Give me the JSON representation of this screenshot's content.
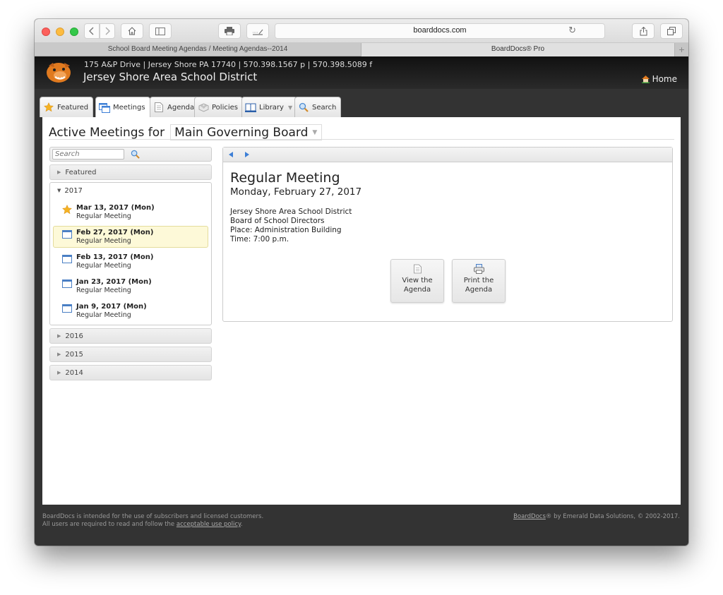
{
  "browser": {
    "url": "boarddocs.com",
    "tabs": [
      {
        "label": "School Board Meeting Agendas / Meeting Agendas--2014",
        "active": false
      },
      {
        "label": "BoardDocs® Pro",
        "active": true
      }
    ],
    "new_tab_label": "+"
  },
  "header": {
    "address": "175 A&P Drive | Jersey Shore PA 17740 | 570.398.1567 p | 570.398.5089 f",
    "district_name": "Jersey Shore Area School District",
    "home_label": "Home"
  },
  "nav": {
    "tabs": [
      {
        "label": "Featured",
        "icon": "star-icon",
        "active": false
      },
      {
        "label": "Meetings",
        "icon": "meetings-icon",
        "active": true
      },
      {
        "label": "Agenda",
        "icon": "document-icon",
        "active": false
      },
      {
        "label": "Policies",
        "icon": "policies-icon",
        "active": false
      },
      {
        "label": "Library",
        "icon": "book-icon",
        "active": false,
        "has_dropdown": true
      },
      {
        "label": "Search",
        "icon": "magnifier-icon",
        "active": false
      }
    ]
  },
  "page": {
    "title_prefix": "Active Meetings for",
    "board_selected": "Main Governing Board"
  },
  "sidebar": {
    "search_placeholder": "Search",
    "featured_label": "Featured",
    "open_year": "2017",
    "meetings": [
      {
        "date": "Mar 13, 2017 (Mon)",
        "type": "Regular Meeting",
        "icon": "star-icon",
        "selected": false
      },
      {
        "date": "Feb 27, 2017 (Mon)",
        "type": "Regular Meeting",
        "icon": "calendar-icon",
        "selected": true
      },
      {
        "date": "Feb 13, 2017 (Mon)",
        "type": "Regular Meeting",
        "icon": "calendar-icon",
        "selected": false
      },
      {
        "date": "Jan 23, 2017 (Mon)",
        "type": "Regular Meeting",
        "icon": "calendar-icon",
        "selected": false
      },
      {
        "date": "Jan 9, 2017 (Mon)",
        "type": "Regular Meeting",
        "icon": "calendar-icon",
        "selected": false
      }
    ],
    "collapsed_years": [
      "2016",
      "2015",
      "2014"
    ]
  },
  "detail": {
    "title": "Regular Meeting",
    "date": "Monday, February 27, 2017",
    "lines": [
      "Jersey Shore Area School District",
      "Board of School Directors",
      "Place: Administration Building",
      "Time: 7:00 p.m."
    ],
    "view_button": {
      "line1": "View the",
      "line2": "Agenda"
    },
    "print_button": {
      "line1": "Print the",
      "line2": "Agenda"
    }
  },
  "footer": {
    "left_line1": "BoardDocs is intended for the use of subscribers and licensed customers.",
    "left_line2_prefix": "All users are required to read and follow the",
    "left_link": "acceptable use policy",
    "left_line2_suffix": ".",
    "right_link": "BoardDocs",
    "right_text": "® by Emerald Data Solutions, © 2002-2017."
  },
  "colors": {
    "accent_blue": "#3d7fd6",
    "selected_row": "#fdf9d8",
    "header_dark": "#1a1a1a",
    "logo_orange": "#e07a1f"
  }
}
